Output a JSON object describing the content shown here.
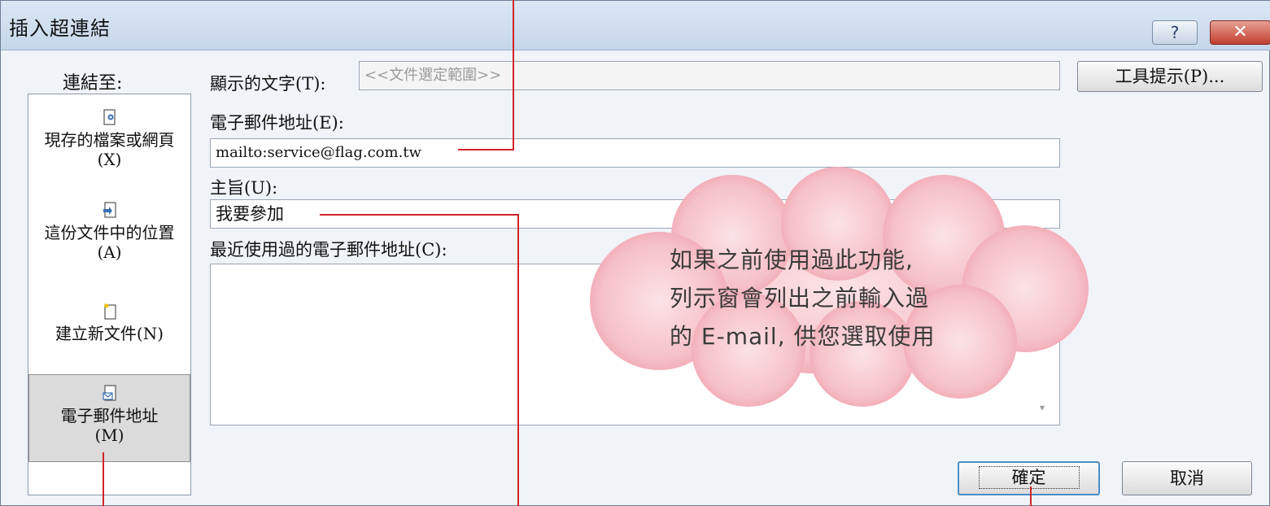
{
  "dialog": {
    "title": "插入超連結",
    "help_label": "?",
    "close_label": "✕"
  },
  "sidebar": {
    "header": "連結至:",
    "items": [
      {
        "icon": "existing-file-icon",
        "label": "現存的檔案或網頁(X)"
      },
      {
        "icon": "place-in-document-icon",
        "label": "這份文件中的位置(A)"
      },
      {
        "icon": "new-document-icon",
        "label": "建立新文件(N)"
      },
      {
        "icon": "email-address-icon",
        "label": "電子郵件地址(M)",
        "selected": true
      }
    ]
  },
  "form": {
    "display_text_label": "顯示的文字(T):",
    "display_text_value": "<<文件選定範圍>>",
    "screentip_button": "工具提示(P)...",
    "email_label": "電子郵件地址(E):",
    "email_value": "mailto:service@flag.com.tw",
    "subject_label": "主旨(U):",
    "subject_value": "我要參加",
    "recent_label": "最近使用過的電子郵件地址(C):"
  },
  "buttons": {
    "ok": "確定",
    "cancel": "取消"
  },
  "annotation": {
    "lines": [
      "如果之前使用過此功能,",
      "列示窗會列出之前輸入過",
      "的 E-mail, 供您選取使用"
    ],
    "cloud_color": "#f4b3bd",
    "callout_color": "#d2232a"
  }
}
